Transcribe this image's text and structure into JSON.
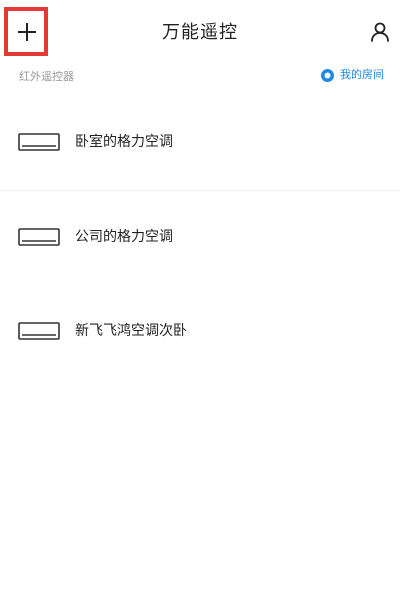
{
  "header": {
    "title": "万能遥控",
    "add_icon": "plus-icon",
    "user_icon": "user-icon"
  },
  "subheader": {
    "section_label": "红外遥控器",
    "room_label": "我的房间",
    "room_icon": "room-icon"
  },
  "devices": [
    {
      "name": "卧室的格力空调",
      "icon": "air-conditioner-icon"
    },
    {
      "name": "公司的格力空调",
      "icon": "air-conditioner-icon"
    },
    {
      "name": "新飞飞鸿空调次卧",
      "icon": "air-conditioner-icon"
    }
  ],
  "colors": {
    "highlight": "#e53935",
    "accent": "#1e88e5",
    "muted": "#999999",
    "text": "#222222"
  }
}
